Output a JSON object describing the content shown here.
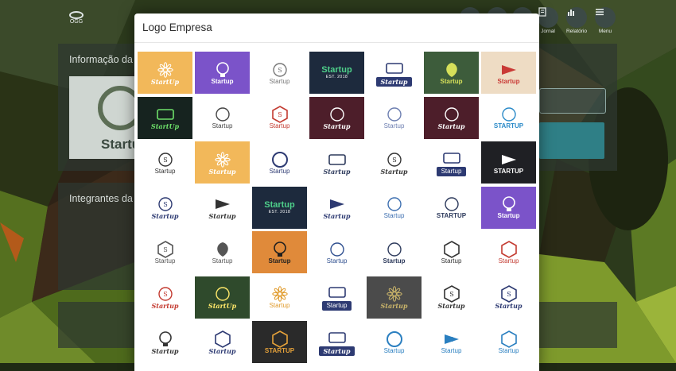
{
  "modal": {
    "title": "Logo Empresa"
  },
  "background": {
    "section_info": "Informação da",
    "section_members": "Integrantes da",
    "card_word": "Startu",
    "nav": [
      {
        "label": "Jornal",
        "icon": "journal-icon"
      },
      {
        "label": "Relatório",
        "icon": "report-icon"
      },
      {
        "label": "Menu",
        "icon": "menu-icon"
      }
    ],
    "brand": "OGG"
  },
  "logos": [
    {
      "id": 1,
      "text": "StartUp",
      "bg": "#f2b85a",
      "fg": "#ffffff",
      "style": "script",
      "icon": "flower-icon"
    },
    {
      "id": 2,
      "text": "Startup",
      "bg": "#7b53c9",
      "fg": "#ffffff",
      "style": "bold",
      "icon": "brain-gear-icon"
    },
    {
      "id": 3,
      "text": "Startup",
      "bg": "#ffffff",
      "fg": "#777777",
      "style": "plain",
      "icon": "s-circle-icon",
      "badge": "S"
    },
    {
      "id": 4,
      "text": "Startup",
      "sub": "EST. 2018",
      "bg": "#1d2a3d",
      "fg": "#4ed08a",
      "style": "bold",
      "icon": ""
    },
    {
      "id": 5,
      "text": "Startup",
      "bg": "#ffffff",
      "fg": "#ffffff",
      "style": "script",
      "icon": "ribbon-icon"
    },
    {
      "id": 6,
      "text": "Startup",
      "bg": "#3d5c3b",
      "fg": "#d6e05a",
      "style": "bold",
      "icon": "leaf-icon"
    },
    {
      "id": 7,
      "text": "Startup",
      "bg": "#eedcc4",
      "fg": "#c93a36",
      "style": "bold",
      "icon": "megaphone-icon"
    },
    {
      "id": 8,
      "text": "StartUp",
      "bg": "#16231f",
      "fg": "#6ee06a",
      "style": "script",
      "icon": "monitor-icon"
    },
    {
      "id": 9,
      "text": "Startup",
      "bg": "#ffffff",
      "fg": "#444444",
      "style": "plain",
      "icon": "globe-icon"
    },
    {
      "id": 10,
      "text": "Startup",
      "bg": "#ffffff",
      "fg": "#c33a30",
      "style": "plain",
      "icon": "hexagon-s-icon",
      "badge": "S"
    },
    {
      "id": 11,
      "text": "Startup",
      "bg": "#4d1e2a",
      "fg": "#ffffff",
      "style": "script",
      "icon": "brush-icon"
    },
    {
      "id": 12,
      "text": "Startup",
      "bg": "#ffffff",
      "fg": "#6c7eb0",
      "style": "plain",
      "icon": "swoosh-icon"
    },
    {
      "id": 13,
      "text": "Startup",
      "bg": "#4d1e2a",
      "fg": "#ffffff",
      "style": "script",
      "icon": "brush-icon"
    },
    {
      "id": 14,
      "text": "STARTUP",
      "bg": "#ffffff",
      "fg": "#2a8ac8",
      "style": "bold",
      "icon": "whale-icon"
    },
    {
      "id": 15,
      "text": "Startup",
      "bg": "#ffffff",
      "fg": "#333333",
      "style": "plain",
      "icon": "s-circle-icon",
      "badge": "S"
    },
    {
      "id": 16,
      "text": "Startup",
      "bg": "#f2b85a",
      "fg": "#ffffff",
      "style": "script",
      "icon": "flower-icon"
    },
    {
      "id": 17,
      "text": "Startup",
      "bg": "#ffffff",
      "fg": "#2d3a72",
      "style": "plain",
      "icon": "circle-ring-icon"
    },
    {
      "id": 18,
      "text": "Startup",
      "bg": "#ffffff",
      "fg": "#2d3a5c",
      "style": "script",
      "icon": "banner-icon"
    },
    {
      "id": 19,
      "text": "Startup",
      "bg": "#ffffff",
      "fg": "#333333",
      "style": "script",
      "icon": "wings-icon",
      "badge": "S"
    },
    {
      "id": 20,
      "text": "Startup",
      "bg": "#ffffff",
      "fg": "#ffffff",
      "style": "plain",
      "icon": "ribbon-blue-icon"
    },
    {
      "id": 21,
      "text": "STARTUP",
      "bg": "#1f2024",
      "fg": "#ffffff",
      "style": "bold",
      "icon": "play-icon"
    },
    {
      "id": 22,
      "text": "Startup",
      "bg": "#ffffff",
      "fg": "#2d3a72",
      "style": "script",
      "icon": "s-circle-icon",
      "badge": "S"
    },
    {
      "id": 23,
      "text": "Startup",
      "bg": "#ffffff",
      "fg": "#333333",
      "style": "script",
      "icon": "rocket-icon"
    },
    {
      "id": 24,
      "text": "Startup",
      "sub": "EST. 2018",
      "bg": "#1d2a3d",
      "fg": "#4ed08a",
      "style": "bold",
      "icon": ""
    },
    {
      "id": 25,
      "text": "Startup",
      "bg": "#ffffff",
      "fg": "#2d3a72",
      "style": "script",
      "icon": "plane-icon"
    },
    {
      "id": 26,
      "text": "Startup",
      "bg": "#ffffff",
      "fg": "#3d6fb0",
      "style": "plain",
      "icon": "arch-icon"
    },
    {
      "id": 27,
      "text": "STARTUP",
      "bg": "#ffffff",
      "fg": "#2d3a5c",
      "style": "bold",
      "icon": "tulip-icon"
    },
    {
      "id": 28,
      "text": "Startup",
      "bg": "#7b53c9",
      "fg": "#ffffff",
      "style": "bold",
      "icon": "bulb-icon"
    },
    {
      "id": 29,
      "text": "Startup",
      "bg": "#ffffff",
      "fg": "#555555",
      "style": "plain",
      "icon": "hexagon-s-icon",
      "badge": "S"
    },
    {
      "id": 30,
      "text": "Startup",
      "bg": "#ffffff",
      "fg": "#555555",
      "style": "plain",
      "icon": "leaf-dots-icon"
    },
    {
      "id": 31,
      "text": "Startup",
      "bg": "#e08a3a",
      "fg": "#1f1f1f",
      "style": "bold",
      "icon": "gear-bulb-icon"
    },
    {
      "id": 32,
      "text": "Startup",
      "bg": "#ffffff",
      "fg": "#2f4f8f",
      "style": "plain",
      "icon": "swoosh-icon"
    },
    {
      "id": 33,
      "text": "Startup",
      "bg": "#ffffff",
      "fg": "#2d3a5c",
      "style": "bold",
      "icon": "hands-icon"
    },
    {
      "id": 34,
      "text": "Startup",
      "bg": "#ffffff",
      "fg": "#333333",
      "style": "plain",
      "icon": "cube-icon"
    },
    {
      "id": 35,
      "text": "Startup",
      "bg": "#ffffff",
      "fg": "#c33a30",
      "style": "plain",
      "icon": "triangle-icon"
    },
    {
      "id": 36,
      "text": "Startup",
      "bg": "#ffffff",
      "fg": "#c33a30",
      "style": "script",
      "icon": "s-square-icon",
      "badge": "S"
    },
    {
      "id": 37,
      "text": "StartUp",
      "bg": "#2f4a2c",
      "fg": "#ffe86a",
      "style": "script",
      "icon": "swoosh-yellow-icon"
    },
    {
      "id": 38,
      "text": "Startup",
      "bg": "#ffffff",
      "fg": "#e09a2a",
      "style": "plain",
      "icon": "sunrise-icon"
    },
    {
      "id": 39,
      "text": "Startup",
      "bg": "#ffffff",
      "fg": "#ffffff",
      "style": "plain",
      "icon": "plaque-icon"
    },
    {
      "id": 40,
      "text": "Startup",
      "bg": "#4b4b4b",
      "fg": "#c9b46a",
      "style": "script",
      "icon": "wreath-icon"
    },
    {
      "id": 41,
      "text": "Startup",
      "bg": "#ffffff",
      "fg": "#333333",
      "style": "script",
      "icon": "diamond-s-icon",
      "badge": "S"
    },
    {
      "id": 42,
      "text": "Startup",
      "bg": "#ffffff",
      "fg": "#2d3a72",
      "style": "script",
      "icon": "shield-s-icon",
      "badge": "S"
    },
    {
      "id": 43,
      "text": "Startup",
      "bg": "#ffffff",
      "fg": "#333333",
      "style": "script",
      "icon": "bulb-outline-icon"
    },
    {
      "id": 44,
      "text": "Startup",
      "bg": "#ffffff",
      "fg": "#2d3a72",
      "style": "script",
      "icon": "shield-banner-icon"
    },
    {
      "id": 45,
      "text": "STARTUP",
      "bg": "#2a2a2a",
      "fg": "#e6a23a",
      "style": "bold",
      "icon": "box-icon"
    },
    {
      "id": 46,
      "text": "Startup",
      "bg": "#ffffff",
      "fg": "#ffffff",
      "style": "script",
      "icon": "city-badge-icon"
    },
    {
      "id": 47,
      "text": "Startup",
      "bg": "#ffffff",
      "fg": "#2a7fc0",
      "style": "plain",
      "icon": "target-icon"
    },
    {
      "id": 48,
      "text": "Startup",
      "bg": "#ffffff",
      "fg": "#2a7fc0",
      "style": "plain",
      "icon": "arrows-s-icon",
      "badge": "S"
    },
    {
      "id": 49,
      "text": "Startup",
      "bg": "#ffffff",
      "fg": "#2a7fc0",
      "style": "plain",
      "icon": "chevron-icon"
    }
  ]
}
